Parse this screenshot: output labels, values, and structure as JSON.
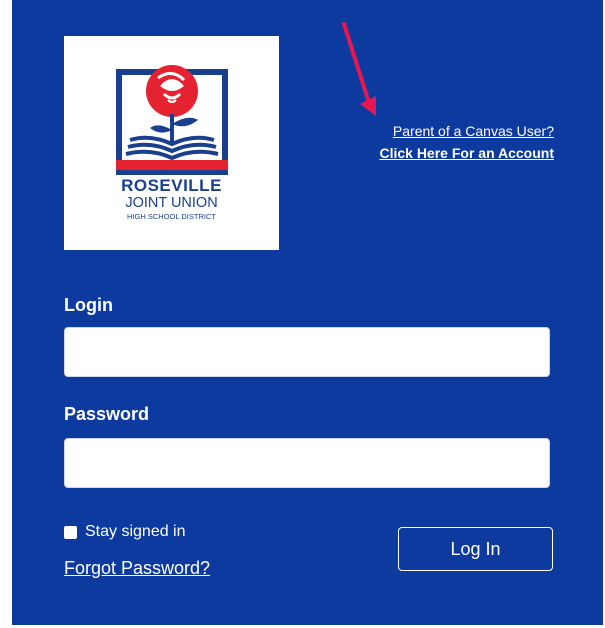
{
  "logo": {
    "line1": "ROSEVILLE",
    "line2": "JOINT UNION",
    "line3": "HIGH SCHOOL DISTRICT"
  },
  "links": {
    "parent": "Parent of a Canvas User?",
    "account": "Click Here For an Account"
  },
  "form": {
    "login_label": "Login",
    "login_value": "",
    "password_label": "Password",
    "password_value": "",
    "stay_signed_in": "Stay signed in",
    "forgot_password": "Forgot Password?",
    "login_button": "Log In"
  },
  "colors": {
    "panel": "#0d3a9e",
    "arrow": "#e8174f",
    "logo_red": "#e52330",
    "logo_blue": "#1b3f8f"
  }
}
